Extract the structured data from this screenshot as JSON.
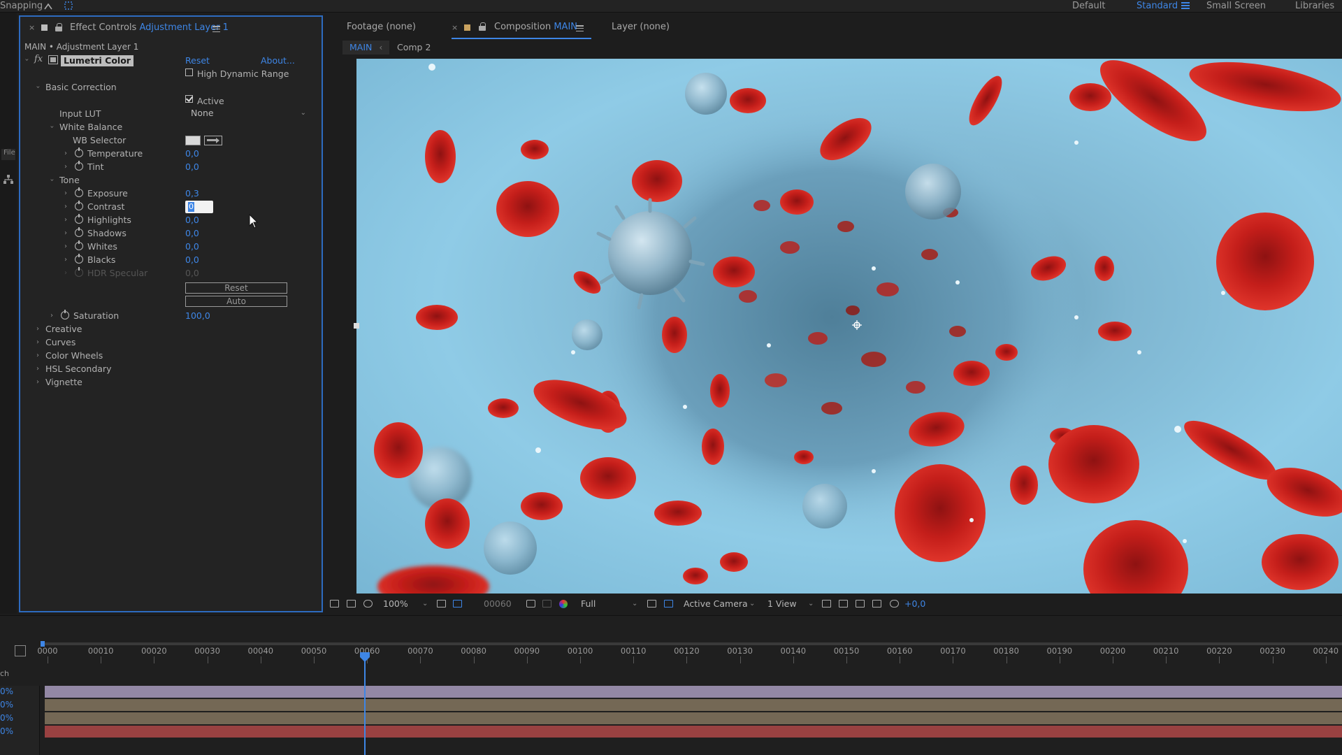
{
  "topbar": {
    "snapping_label": "Snapping",
    "workspaces": [
      "Default",
      "Standard",
      "Small Screen",
      "Libraries"
    ],
    "active_workspace": "Standard"
  },
  "left_stub": {
    "file_tab": "File"
  },
  "effect_controls": {
    "tab_prefix": "Effect Controls",
    "tab_layer": "Adjustment Layer 1",
    "layer_path": "MAIN • Adjustment Layer 1",
    "effect_name": "Lumetri Color",
    "reset_label": "Reset",
    "about_label": "About...",
    "hdr_label": "High Dynamic Range",
    "basic_correction": "Basic Correction",
    "active_label": "Active",
    "input_lut_label": "Input LUT",
    "input_lut_value": "None",
    "white_balance": "White Balance",
    "wb_selector": "WB Selector",
    "temperature": {
      "label": "Temperature",
      "value": "0,0"
    },
    "tint": {
      "label": "Tint",
      "value": "0,0"
    },
    "tone": "Tone",
    "exposure": {
      "label": "Exposure",
      "value": "0,3"
    },
    "contrast": {
      "label": "Contrast",
      "value": "0"
    },
    "highlights": {
      "label": "Highlights",
      "value": "0,0"
    },
    "shadows": {
      "label": "Shadows",
      "value": "0,0"
    },
    "whites": {
      "label": "Whites",
      "value": "0,0"
    },
    "blacks": {
      "label": "Blacks",
      "value": "0,0"
    },
    "hdr_specular": {
      "label": "HDR Specular",
      "value": "0,0"
    },
    "tone_reset": "Reset",
    "tone_auto": "Auto",
    "saturation": {
      "label": "Saturation",
      "value": "100,0"
    },
    "sections": [
      "Creative",
      "Curves",
      "Color Wheels",
      "HSL Secondary",
      "Vignette"
    ]
  },
  "comp_panel": {
    "footage_tab": "Footage  (none)",
    "composition_prefix": "Composition",
    "composition_name": "MAIN",
    "layer_tab": "Layer  (none)",
    "subtabs": [
      "MAIN",
      "Comp 2"
    ],
    "active_subtab": "MAIN"
  },
  "viewer_toolbar": {
    "zoom": "100%",
    "timecode": "00060",
    "resolution": "Full",
    "camera": "Active Camera",
    "views": "1 View",
    "exposure_offset": "+0,0"
  },
  "timeline": {
    "ruler_labels": [
      "0000",
      "00010",
      "00020",
      "00030",
      "00040",
      "00050",
      "00060",
      "00070",
      "00080",
      "00090",
      "00100",
      "00110",
      "00120",
      "00130",
      "00140",
      "00150",
      "00160",
      "00170",
      "00180",
      "00190",
      "00200",
      "00210",
      "00220",
      "00230",
      "00240"
    ],
    "ch_label": "ch",
    "percent_values": [
      "0%",
      "0%",
      "0%",
      "0%"
    ],
    "playhead_frame": 60,
    "track_colors": [
      "#a89bbd",
      "#8a7b63",
      "#8a7b63",
      "#b84a4a"
    ]
  },
  "colors": {
    "accent": "#3e86e6",
    "panel_bg": "#232323",
    "focus_border": "#2d6bc0"
  }
}
